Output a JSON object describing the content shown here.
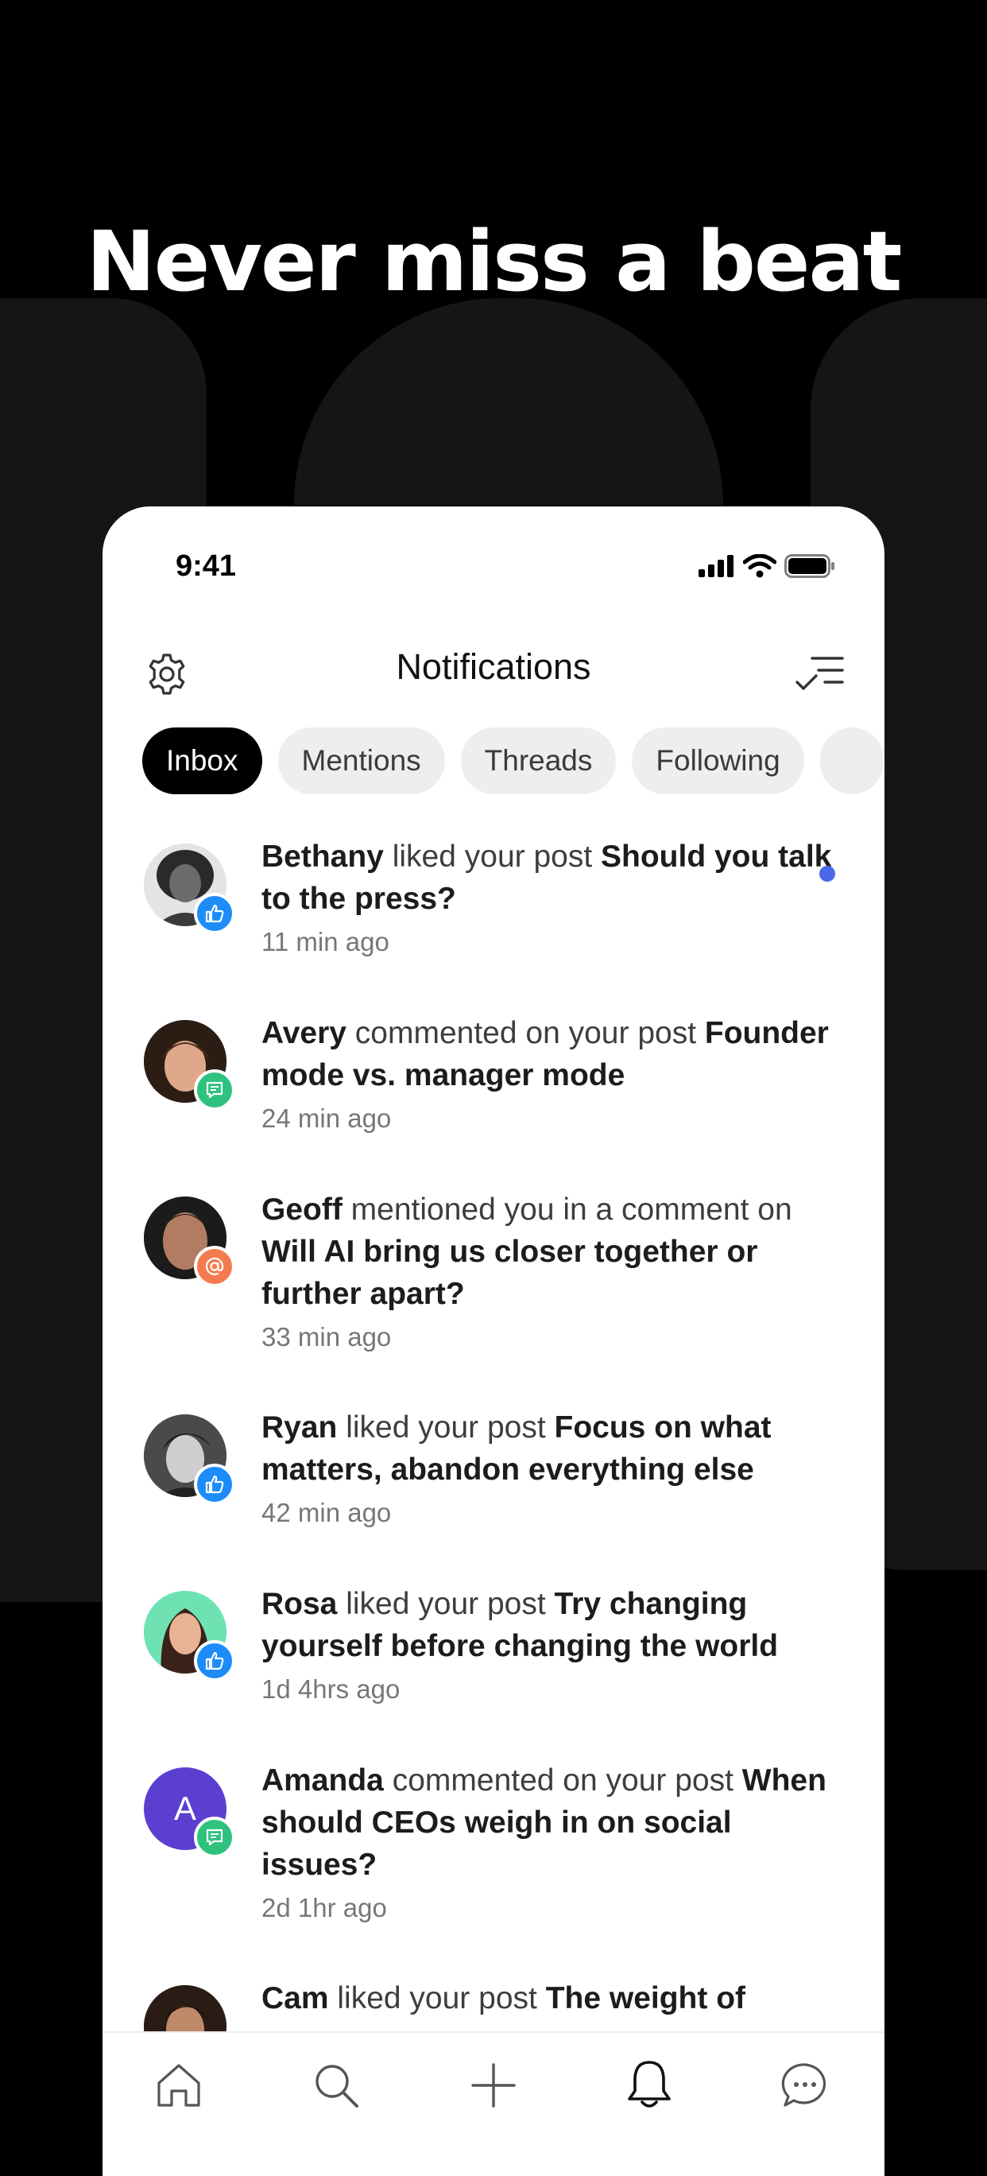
{
  "hero": {
    "title": "Never miss a beat"
  },
  "status_bar": {
    "time": "9:41"
  },
  "header": {
    "title": "Notifications"
  },
  "tabs": [
    {
      "label": "Inbox",
      "active": true
    },
    {
      "label": "Mentions",
      "active": false
    },
    {
      "label": "Threads",
      "active": false
    },
    {
      "label": "Following",
      "active": false
    }
  ],
  "notifications": [
    {
      "name": "Bethany",
      "action": " liked your post ",
      "post": "Should you talk to the press?",
      "time": "11 min ago",
      "badge": "like-icon",
      "unread": true
    },
    {
      "name": "Avery",
      "action": " commented on your post ",
      "post": "Founder mode vs. manager mode",
      "time": "24 min ago",
      "badge": "comment-icon",
      "unread": false
    },
    {
      "name": "Geoff",
      "action": " mentioned you in a comment on ",
      "post": "Will AI bring us closer together or further apart?",
      "time": "33 min ago",
      "badge": "mention-icon",
      "unread": false
    },
    {
      "name": "Ryan",
      "action": " liked your post ",
      "post": "Focus on what matters, abandon everything else",
      "time": "42 min ago",
      "badge": "like-icon",
      "unread": false
    },
    {
      "name": "Rosa",
      "action": " liked your post ",
      "post": "Try changing yourself before changing the world",
      "time": "1d 4hrs ago",
      "badge": "like-icon",
      "unread": false
    },
    {
      "name": "Amanda",
      "action": " commented on your post ",
      "post": "When should CEOs weigh in on social issues?",
      "time": "2d 1hr ago",
      "badge": "comment-icon",
      "unread": false,
      "initial": "A"
    },
    {
      "name": "Cam",
      "action": " liked your post ",
      "post": "The weight of",
      "time": "",
      "badge": "like-icon",
      "unread": false
    }
  ],
  "colors": {
    "like_badge": "#1d8cf8",
    "comment_badge": "#2ec27e",
    "mention_badge": "#f47b4f",
    "unread_dot": "#4a68e8",
    "avatar_purple": "#5a3fd0"
  },
  "bottom_tabs": [
    "home-icon",
    "search-icon",
    "plus-icon",
    "bell-icon",
    "chat-icon"
  ]
}
